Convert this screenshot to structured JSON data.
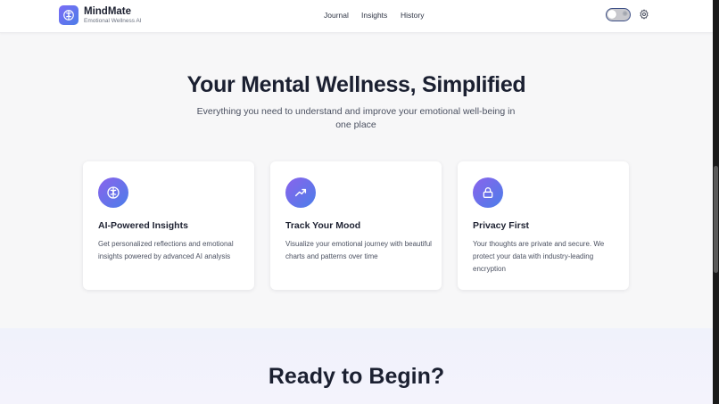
{
  "header": {
    "brand_name": "MindMate",
    "brand_tagline": "Emotional Wellness AI",
    "logo_icon": "brain-icon",
    "nav": [
      "Journal",
      "Insights",
      "History"
    ],
    "theme_toggle_icon": "sun-icon",
    "settings_icon": "gear-icon"
  },
  "hero": {
    "title": "Your Mental Wellness, Simplified",
    "subtitle": "Everything you need to understand and improve your emotional well-being in one place"
  },
  "features": [
    {
      "icon": "brain-icon",
      "title": "AI-Powered Insights",
      "text": "Get personalized reflections and emotional insights powered by advanced AI analysis"
    },
    {
      "icon": "trend-up-icon",
      "title": "Track Your Mood",
      "text": "Visualize your emotional journey with beautiful charts and patterns over time"
    },
    {
      "icon": "lock-icon",
      "title": "Privacy First",
      "text": "Your thoughts are private and secure. We protect your data with industry-leading encryption"
    }
  ],
  "cta": {
    "title": "Ready to Begin?"
  },
  "colors": {
    "accent_start": "#8a63ec",
    "accent_end": "#4b7ee9",
    "text_dark": "#1b2031",
    "text_muted": "#4b5161"
  }
}
